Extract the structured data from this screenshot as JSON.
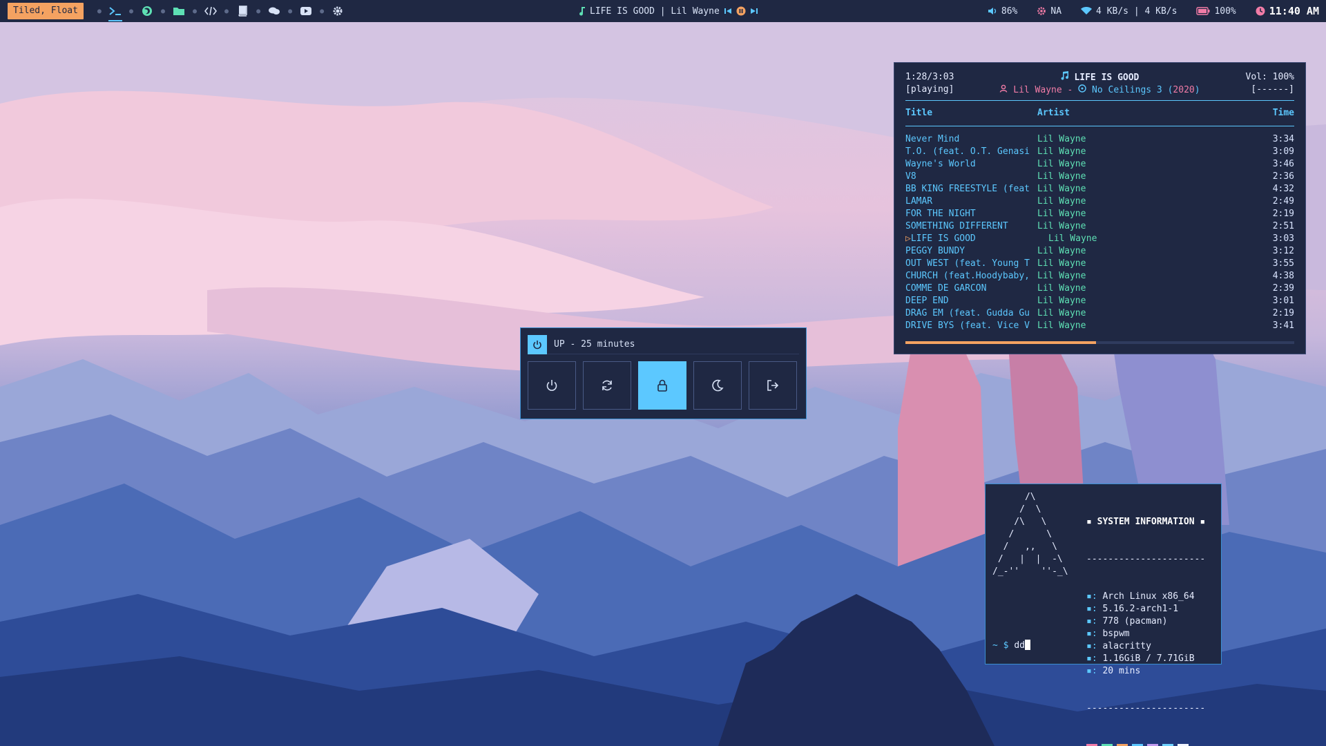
{
  "topbar": {
    "layout_label": "Tiled, Float",
    "workspaces": [
      {
        "icon": "terminal-icon",
        "active": true
      },
      {
        "icon": "firefox-icon",
        "active": false
      },
      {
        "icon": "folder-icon",
        "active": false
      },
      {
        "icon": "code-icon",
        "active": false
      },
      {
        "icon": "book-icon",
        "active": false
      },
      {
        "icon": "chat-icon",
        "active": false
      },
      {
        "icon": "youtube-icon",
        "active": false
      },
      {
        "icon": "gear-icon",
        "active": false
      }
    ],
    "now_playing": "LIFE IS GOOD | Lil Wayne",
    "volume": "86%",
    "cpu_temp": "NA",
    "network": "4 KB/s | 4 KB/s",
    "battery": "100%",
    "clock": "11:40 AM"
  },
  "player": {
    "elapsed": "1:28/3:03",
    "state": "[playing]",
    "title": "LIFE IS GOOD",
    "artist": "Lil Wayne",
    "album_separator": "-",
    "album": "No Ceilings 3",
    "year": "2020",
    "volume": "Vol: 100%",
    "flags": "[------]",
    "columns": {
      "title": "Title",
      "artist": "Artist",
      "time": "Time"
    },
    "progress": 0.49,
    "tracks": [
      {
        "title": "Never Mind",
        "artist": "Lil Wayne",
        "time": "3:34"
      },
      {
        "title": "T.O. (feat. O.T. Genasi",
        "artist": "Lil Wayne",
        "time": "3:09"
      },
      {
        "title": "Wayne's World",
        "artist": "Lil Wayne",
        "time": "3:46"
      },
      {
        "title": "V8",
        "artist": "Lil Wayne",
        "time": "2:36"
      },
      {
        "title": "BB KING FREESTYLE (feat",
        "artist": "Lil Wayne",
        "time": "4:32"
      },
      {
        "title": "LAMAR",
        "artist": "Lil Wayne",
        "time": "2:49"
      },
      {
        "title": "FOR THE NIGHT",
        "artist": "Lil Wayne",
        "time": "2:19"
      },
      {
        "title": "SOMETHING DIFFERENT",
        "artist": "Lil Wayne",
        "time": "2:51"
      },
      {
        "title": "LIFE IS GOOD",
        "artist": "Lil Wayne",
        "time": "3:03",
        "current": true
      },
      {
        "title": "PEGGY BUNDY",
        "artist": "Lil Wayne",
        "time": "3:12"
      },
      {
        "title": "OUT WEST (feat. Young T",
        "artist": "Lil Wayne",
        "time": "3:55"
      },
      {
        "title": "CHURCH (feat.Hoodybaby,",
        "artist": "Lil Wayne",
        "time": "4:38"
      },
      {
        "title": "COMME DE GARCON",
        "artist": "Lil Wayne",
        "time": "2:39"
      },
      {
        "title": "DEEP END",
        "artist": "Lil Wayne",
        "time": "3:01"
      },
      {
        "title": "DRAG EM (feat. Gudda Gu",
        "artist": "Lil Wayne",
        "time": "2:19"
      },
      {
        "title": "DRIVE BYS (feat. Vice V",
        "artist": "Lil Wayne",
        "time": "3:41"
      }
    ]
  },
  "powermenu": {
    "uptime": "UP - 25 minutes",
    "buttons": [
      {
        "name": "shutdown",
        "icon": "power-icon",
        "selected": false
      },
      {
        "name": "reboot",
        "icon": "refresh-icon",
        "selected": false
      },
      {
        "name": "lock",
        "icon": "lock-icon",
        "selected": true
      },
      {
        "name": "suspend",
        "icon": "moon-icon",
        "selected": false
      },
      {
        "name": "logout",
        "icon": "logout-icon",
        "selected": false
      }
    ]
  },
  "terminal": {
    "ascii_art": "      /\\\n     /  \\\n    /\\   \\\n   /      \\\n  /   ,,   \\\n /   |  |  -\\\n/_-''    ''-_\\",
    "sysinfo_title": "▪ SYSTEM INFORMATION ▪",
    "divider": "----------------------",
    "info_lines": [
      "Arch Linux x86_64",
      "5.16.2-arch1-1",
      "778 (pacman)",
      "bspwm",
      "alacritty",
      "1.16GiB / 7.71GiB",
      "20 mins"
    ],
    "info_marker": "▪:",
    "palette": [
      "#f27ca7",
      "#5ee0b4",
      "#f4a261",
      "#5cc8ff",
      "#c39bf0",
      "#6fd3ff",
      "#f3f6ff"
    ],
    "prompt": "~ $",
    "command": "dd"
  }
}
